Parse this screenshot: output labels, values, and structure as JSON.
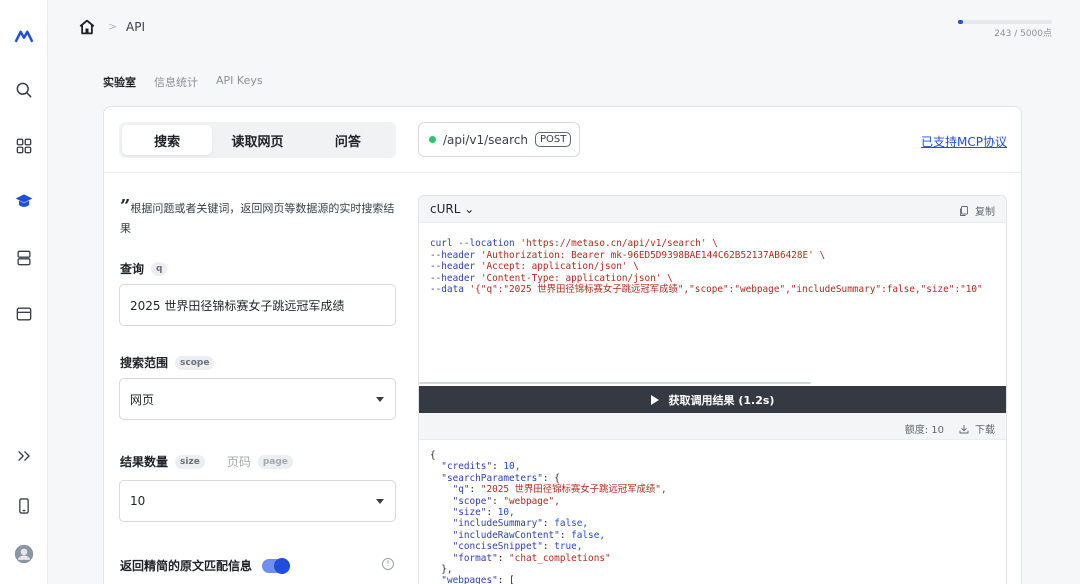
{
  "breadcrumb": {
    "current": "API"
  },
  "quota": {
    "used": 243,
    "total": 5000,
    "fraction": 0.0486,
    "text": "243 / 5000点",
    "accent": "#1f4ed8"
  },
  "section_tabs": [
    "实验室",
    "信息统计",
    "API Keys"
  ],
  "segments": [
    "搜索",
    "读取网页",
    "问答"
  ],
  "endpoint": {
    "path": "/api/v1/search",
    "method": "POST",
    "status_color": "#28c76f"
  },
  "mcp_link": "已支持MCP协议",
  "description": "根据问题或者关键词，返回网页等数据源的实时搜索结果",
  "quote_mark": "”",
  "fields": {
    "query": {
      "label": "查询",
      "tag": "q",
      "value": "2025 世界田径锦标赛女子跳远冠军成绩"
    },
    "scope": {
      "label": "搜索范围",
      "tag": "scope",
      "value": "网页"
    },
    "size": {
      "label": "结果数量",
      "tag": "size",
      "page_label": "页码",
      "page_tag": "page",
      "value": "10"
    },
    "concise": {
      "label": "返回精简的原文匹配信息",
      "enabled": true
    }
  },
  "code": {
    "lang": "cURL",
    "copy_label": "复制",
    "lines": [
      {
        "k": "curl --location ",
        "s": "'https://metaso.cn/api/v1/search' \\"
      },
      {
        "k": "--header ",
        "s": "'Authorization: Bearer mk-96ED5D9398BAE144C62B52137AB6428E' \\"
      },
      {
        "k": "--header ",
        "s": "'Accept: application/json' \\"
      },
      {
        "k": "--header ",
        "s": "'Content-Type: application/json' \\"
      },
      {
        "k": "--data ",
        "s": "'{\"q\":\"2025 世界田径锦标赛女子跳远冠军成绩\",\"scope\":\"webpage\",\"includeSummary\":false,\"size\":\"10\""
      }
    ]
  },
  "run_button": "获取调用结果 (1.2s)",
  "result": {
    "credits_label": "额度: 10",
    "download_label": "下载",
    "json_lines": [
      "{",
      "  \"credits\": 10,",
      "  \"searchParameters\": {",
      "    \"q\": \"2025 世界田径锦标赛女子跳远冠军成绩\",",
      "    \"scope\": \"webpage\",",
      "    \"size\": 10,",
      "    \"includeSummary\": false,",
      "    \"includeRawContent\": false,",
      "    \"conciseSnippet\": true,",
      "    \"format\": \"chat_completions\"",
      "  },",
      "  \"webpages\": ["
    ]
  }
}
